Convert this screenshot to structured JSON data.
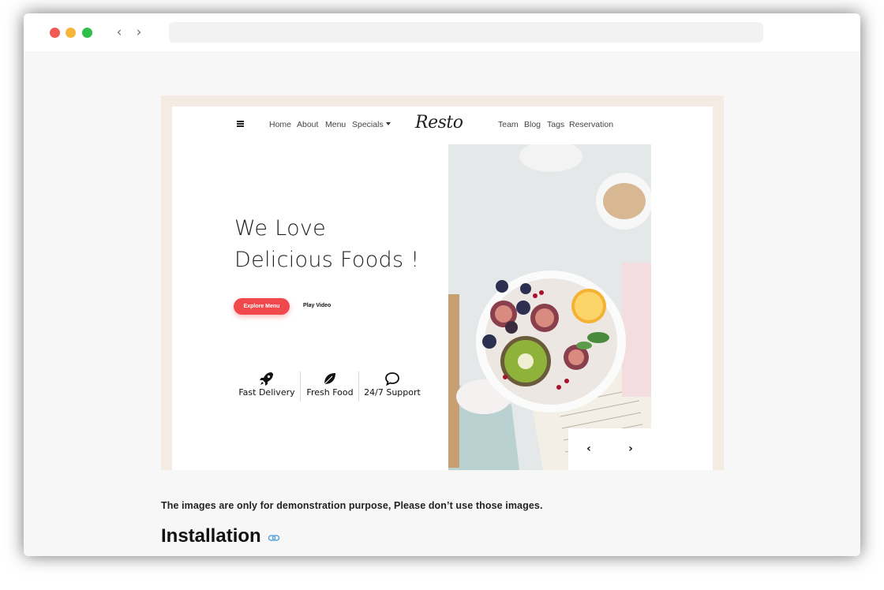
{
  "site": {
    "nav_left": [
      "Home",
      "About",
      "Menu",
      "Specials"
    ],
    "logo": "Resto",
    "nav_right": [
      "Team",
      "Blog",
      "Tags",
      "Reservation"
    ]
  },
  "hero": {
    "title_line1": "We Love",
    "title_line2": "Delicious Foods !",
    "explore_button": "Explore Menu",
    "play_button": "Play Video",
    "features": [
      "Fast Delivery",
      "Fresh Food",
      "24/7 Support"
    ],
    "feature_icons": [
      "rocket-icon",
      "leaf-icon",
      "chat-bubble-icon"
    ],
    "slider_prev": "‹",
    "slider_next": "›"
  },
  "page": {
    "note": "The images are only for demonstration purpose, Please don’t use those images.",
    "section_title": "Installation"
  },
  "colors": {
    "accent": "#f0484c",
    "frame": "#f4ebe3",
    "link_icon": "#59a7d9"
  }
}
